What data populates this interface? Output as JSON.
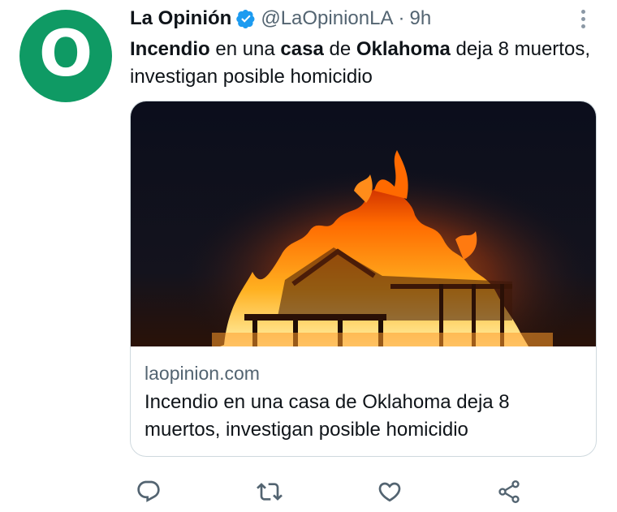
{
  "tweet": {
    "avatar_letter": "O",
    "author_name": "La Opinión",
    "handle": "@LaOpinionLA",
    "separator": "·",
    "time": "9h",
    "text_parts": [
      {
        "text": "Incendio",
        "bold": true
      },
      {
        "text": " en una ",
        "bold": false
      },
      {
        "text": "casa",
        "bold": true
      },
      {
        "text": " de ",
        "bold": false
      },
      {
        "text": "Oklahoma",
        "bold": true
      },
      {
        "text": " deja 8 muertos, investigan posible homicidio",
        "bold": false
      }
    ]
  },
  "card": {
    "domain": "laopinion.com",
    "title": "Incendio en una casa de Oklahoma deja 8 muertos, investigan posible homicidio"
  },
  "actions": [
    {
      "name": "reply",
      "icon": "reply-icon"
    },
    {
      "name": "retweet",
      "icon": "retweet-icon"
    },
    {
      "name": "like",
      "icon": "heart-icon"
    },
    {
      "name": "share",
      "icon": "share-icon"
    }
  ],
  "colors": {
    "avatar_green": "#0f9a64",
    "verified_blue": "#1d9bf0",
    "secondary_text": "#536471",
    "action_icon": "#536471"
  }
}
